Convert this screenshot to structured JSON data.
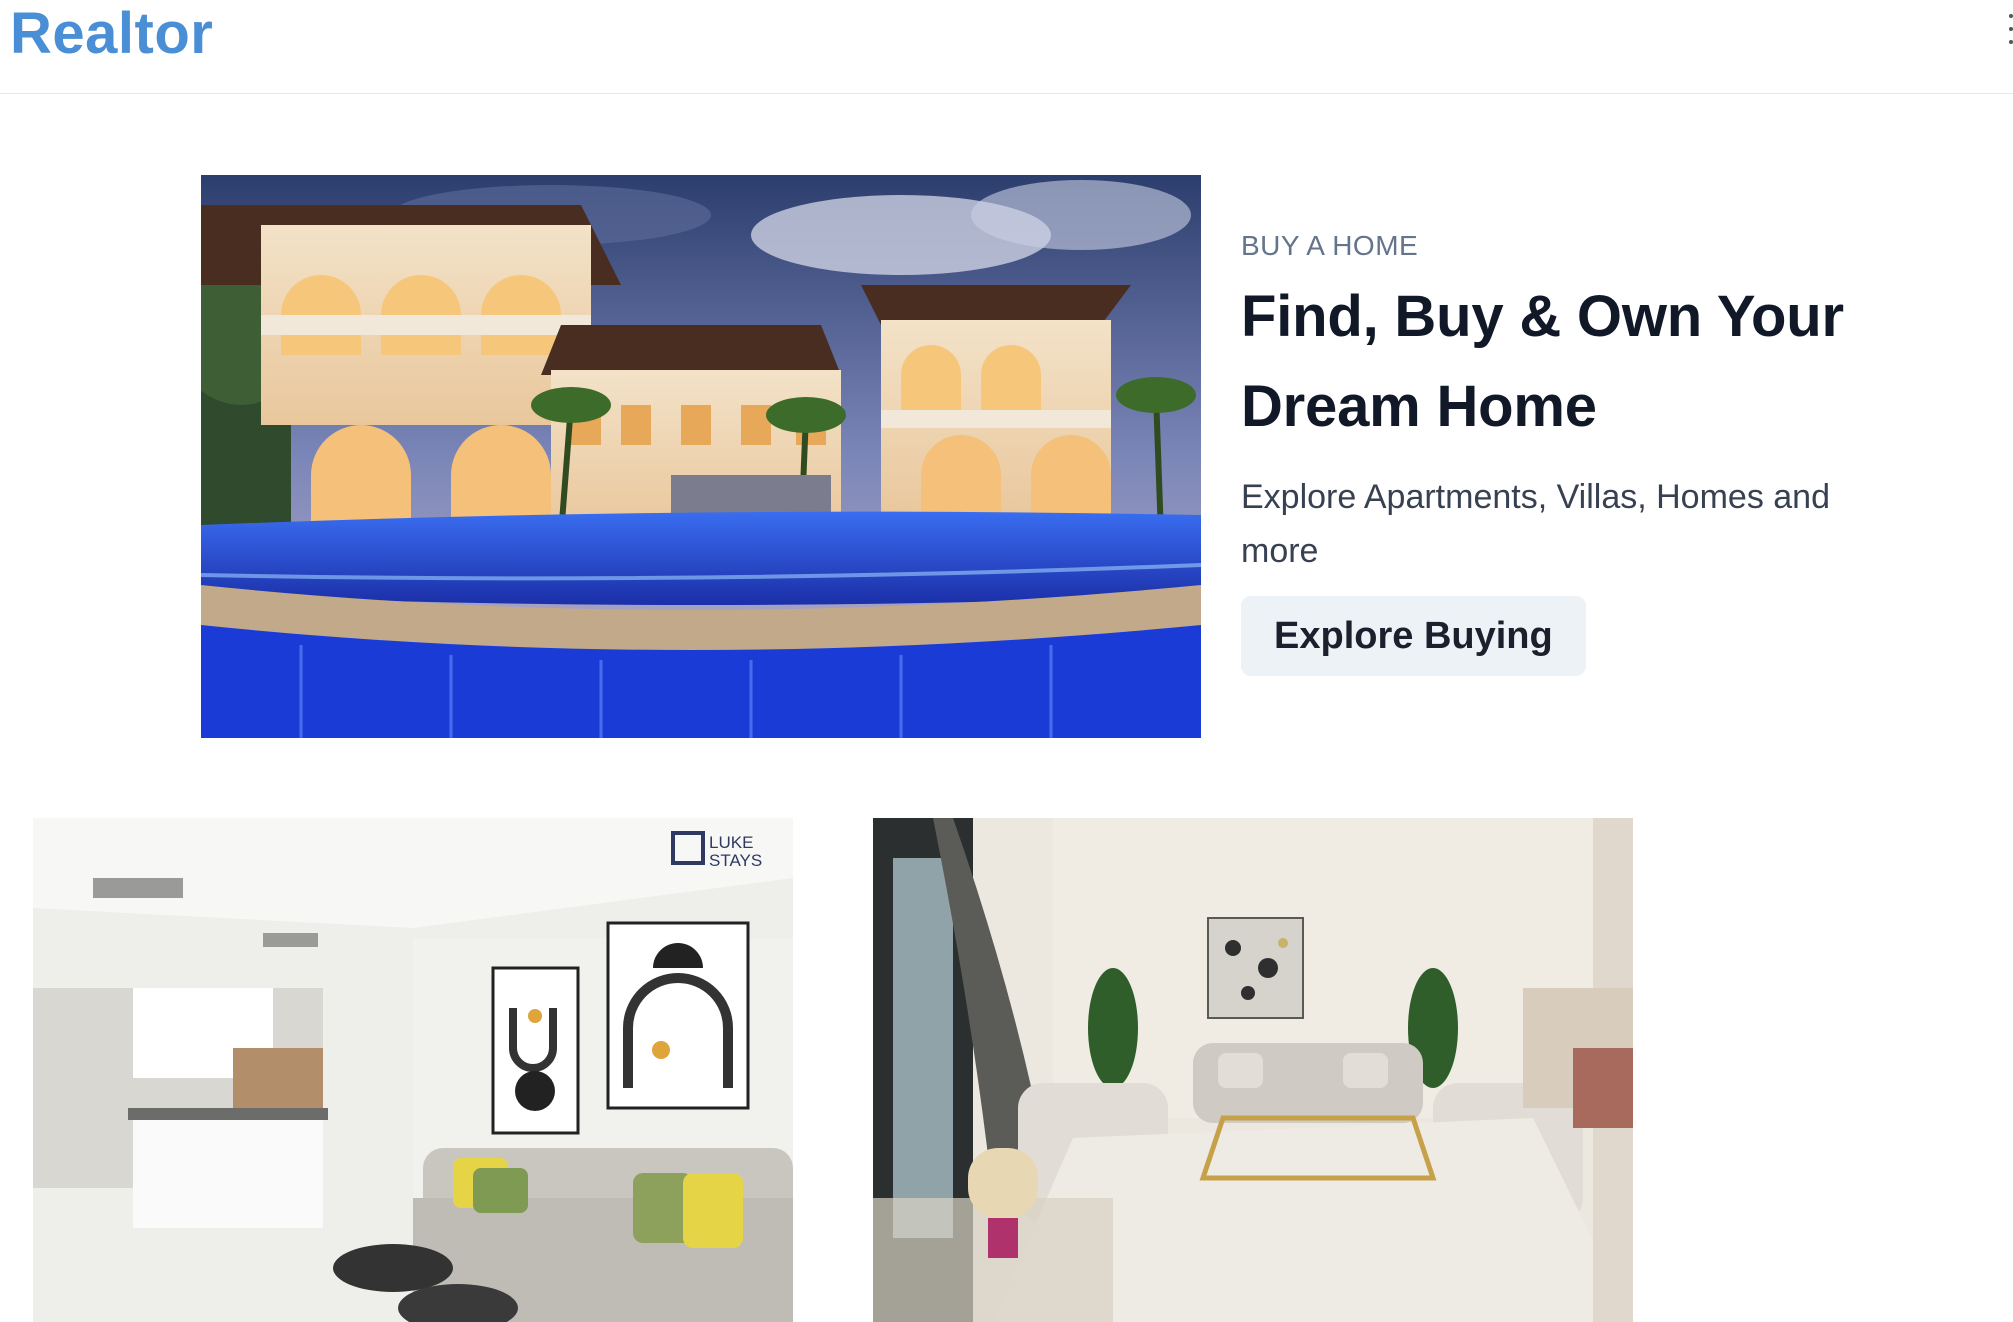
{
  "nav": {
    "brand": "Realtor"
  },
  "hero": {
    "eyebrow": "BUY A HOME",
    "headline": "Find, Buy & Own Your Dream Home",
    "subtext": "Explore Apartments, Villas, Homes and more",
    "cta_label": "Explore Buying",
    "image_alt": "Luxury villa with pool at dusk"
  },
  "listings": [
    {
      "image_alt": "Modern apartment living room with kitchen",
      "watermark_line1": "LUKE",
      "watermark_line2": "STAYS"
    },
    {
      "image_alt": "Elegant living room with sofas and glass table"
    }
  ],
  "colors": {
    "brand": "#4a8fd6",
    "cta_bg": "#edf2f7",
    "headline": "#111827",
    "eyebrow": "#64748b"
  }
}
